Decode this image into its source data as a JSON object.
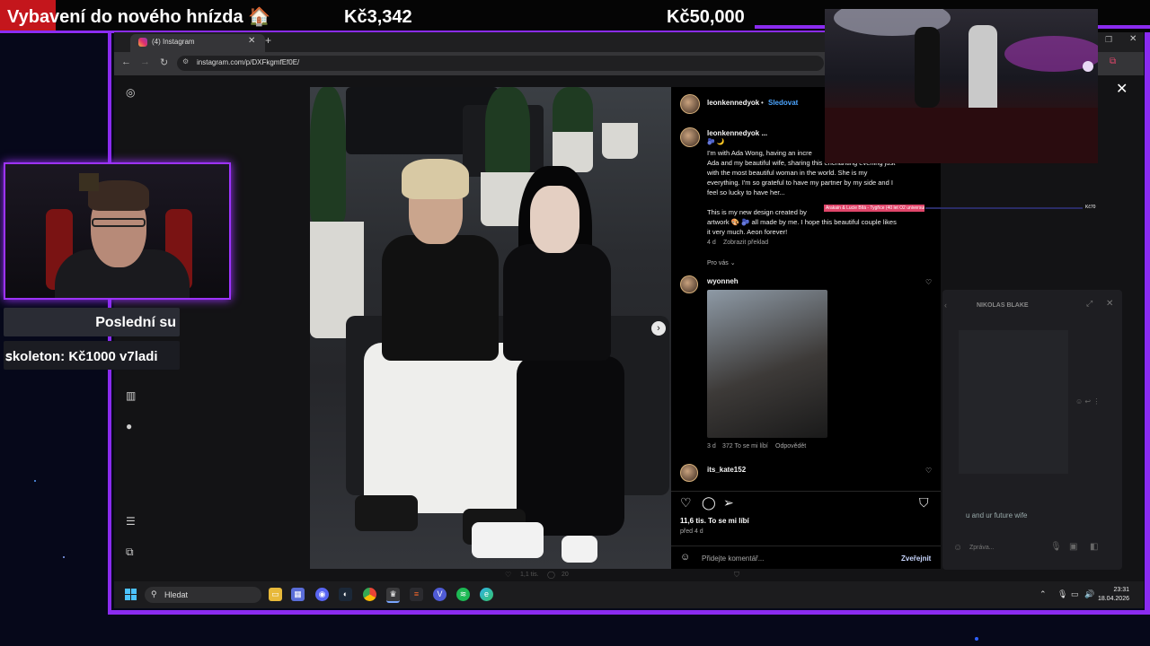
{
  "stream": {
    "goal_title": "Vybavení do nového hnízda 🏠",
    "goal_current": "Kč3,342",
    "goal_target": "Kč50,000",
    "ticker_top": "Poslední su",
    "ticker_bottom": "ꜱkoleton: Kč1000    v7ladi",
    "mini_alert": "Arakain & Lucie Bílá - Tygřice (40 let O2 universum Live)",
    "mini_amount": "Kč70",
    "colors": {
      "frame": "#8a2bf0",
      "goal_red": "#c4161c"
    }
  },
  "browser": {
    "tab_title": "(4) Instagram",
    "url": "instagram.com/p/DXFkgmfEf0E/"
  },
  "post": {
    "author": "leonkennedyok",
    "follow_label": "Sledovat",
    "caption_author": "leonkennedyok ...",
    "caption_emojis": "🫐 🌙",
    "caption_lines": [
      "I'm with Ada Wong, having an incre",
      "Ada and my beautiful wife, sharing this enchanting evening just",
      "with the most beautiful woman in the world. She is my",
      "everything. I'm so grateful to have my partner by my side and I",
      "feel so lucky to have her...",
      "",
      "This is my new design created by",
      "artwork 🎨 🫐 all made by me. I hope this beautiful couple likes",
      "it very much. Aeon forever!"
    ],
    "caption_time": "4 d",
    "translate_label": "Zobrazit překlad",
    "for_you_label": "Pro vás",
    "comments": [
      {
        "user": "wyonneh",
        "time": "3 d",
        "likes": "372 To se mi líbí",
        "reply": "Odpovědět"
      },
      {
        "user": "its_kate152"
      }
    ],
    "likes_text": "11,6 tis. To se mi líbí",
    "date_text": "před 4 d",
    "comment_placeholder": "Přidejte komentář...",
    "publish_label": "Zveřejnit",
    "below_likes": "1,1 tis.",
    "below_comments": "20"
  },
  "ghost": {
    "title": "NIKOLAS BLAKE",
    "text": "u and ur future wife",
    "input_placeholder": "Zpráva..."
  },
  "taskbar": {
    "search_label": "Hledat",
    "time": "23:31",
    "date": "18.04.2026"
  }
}
